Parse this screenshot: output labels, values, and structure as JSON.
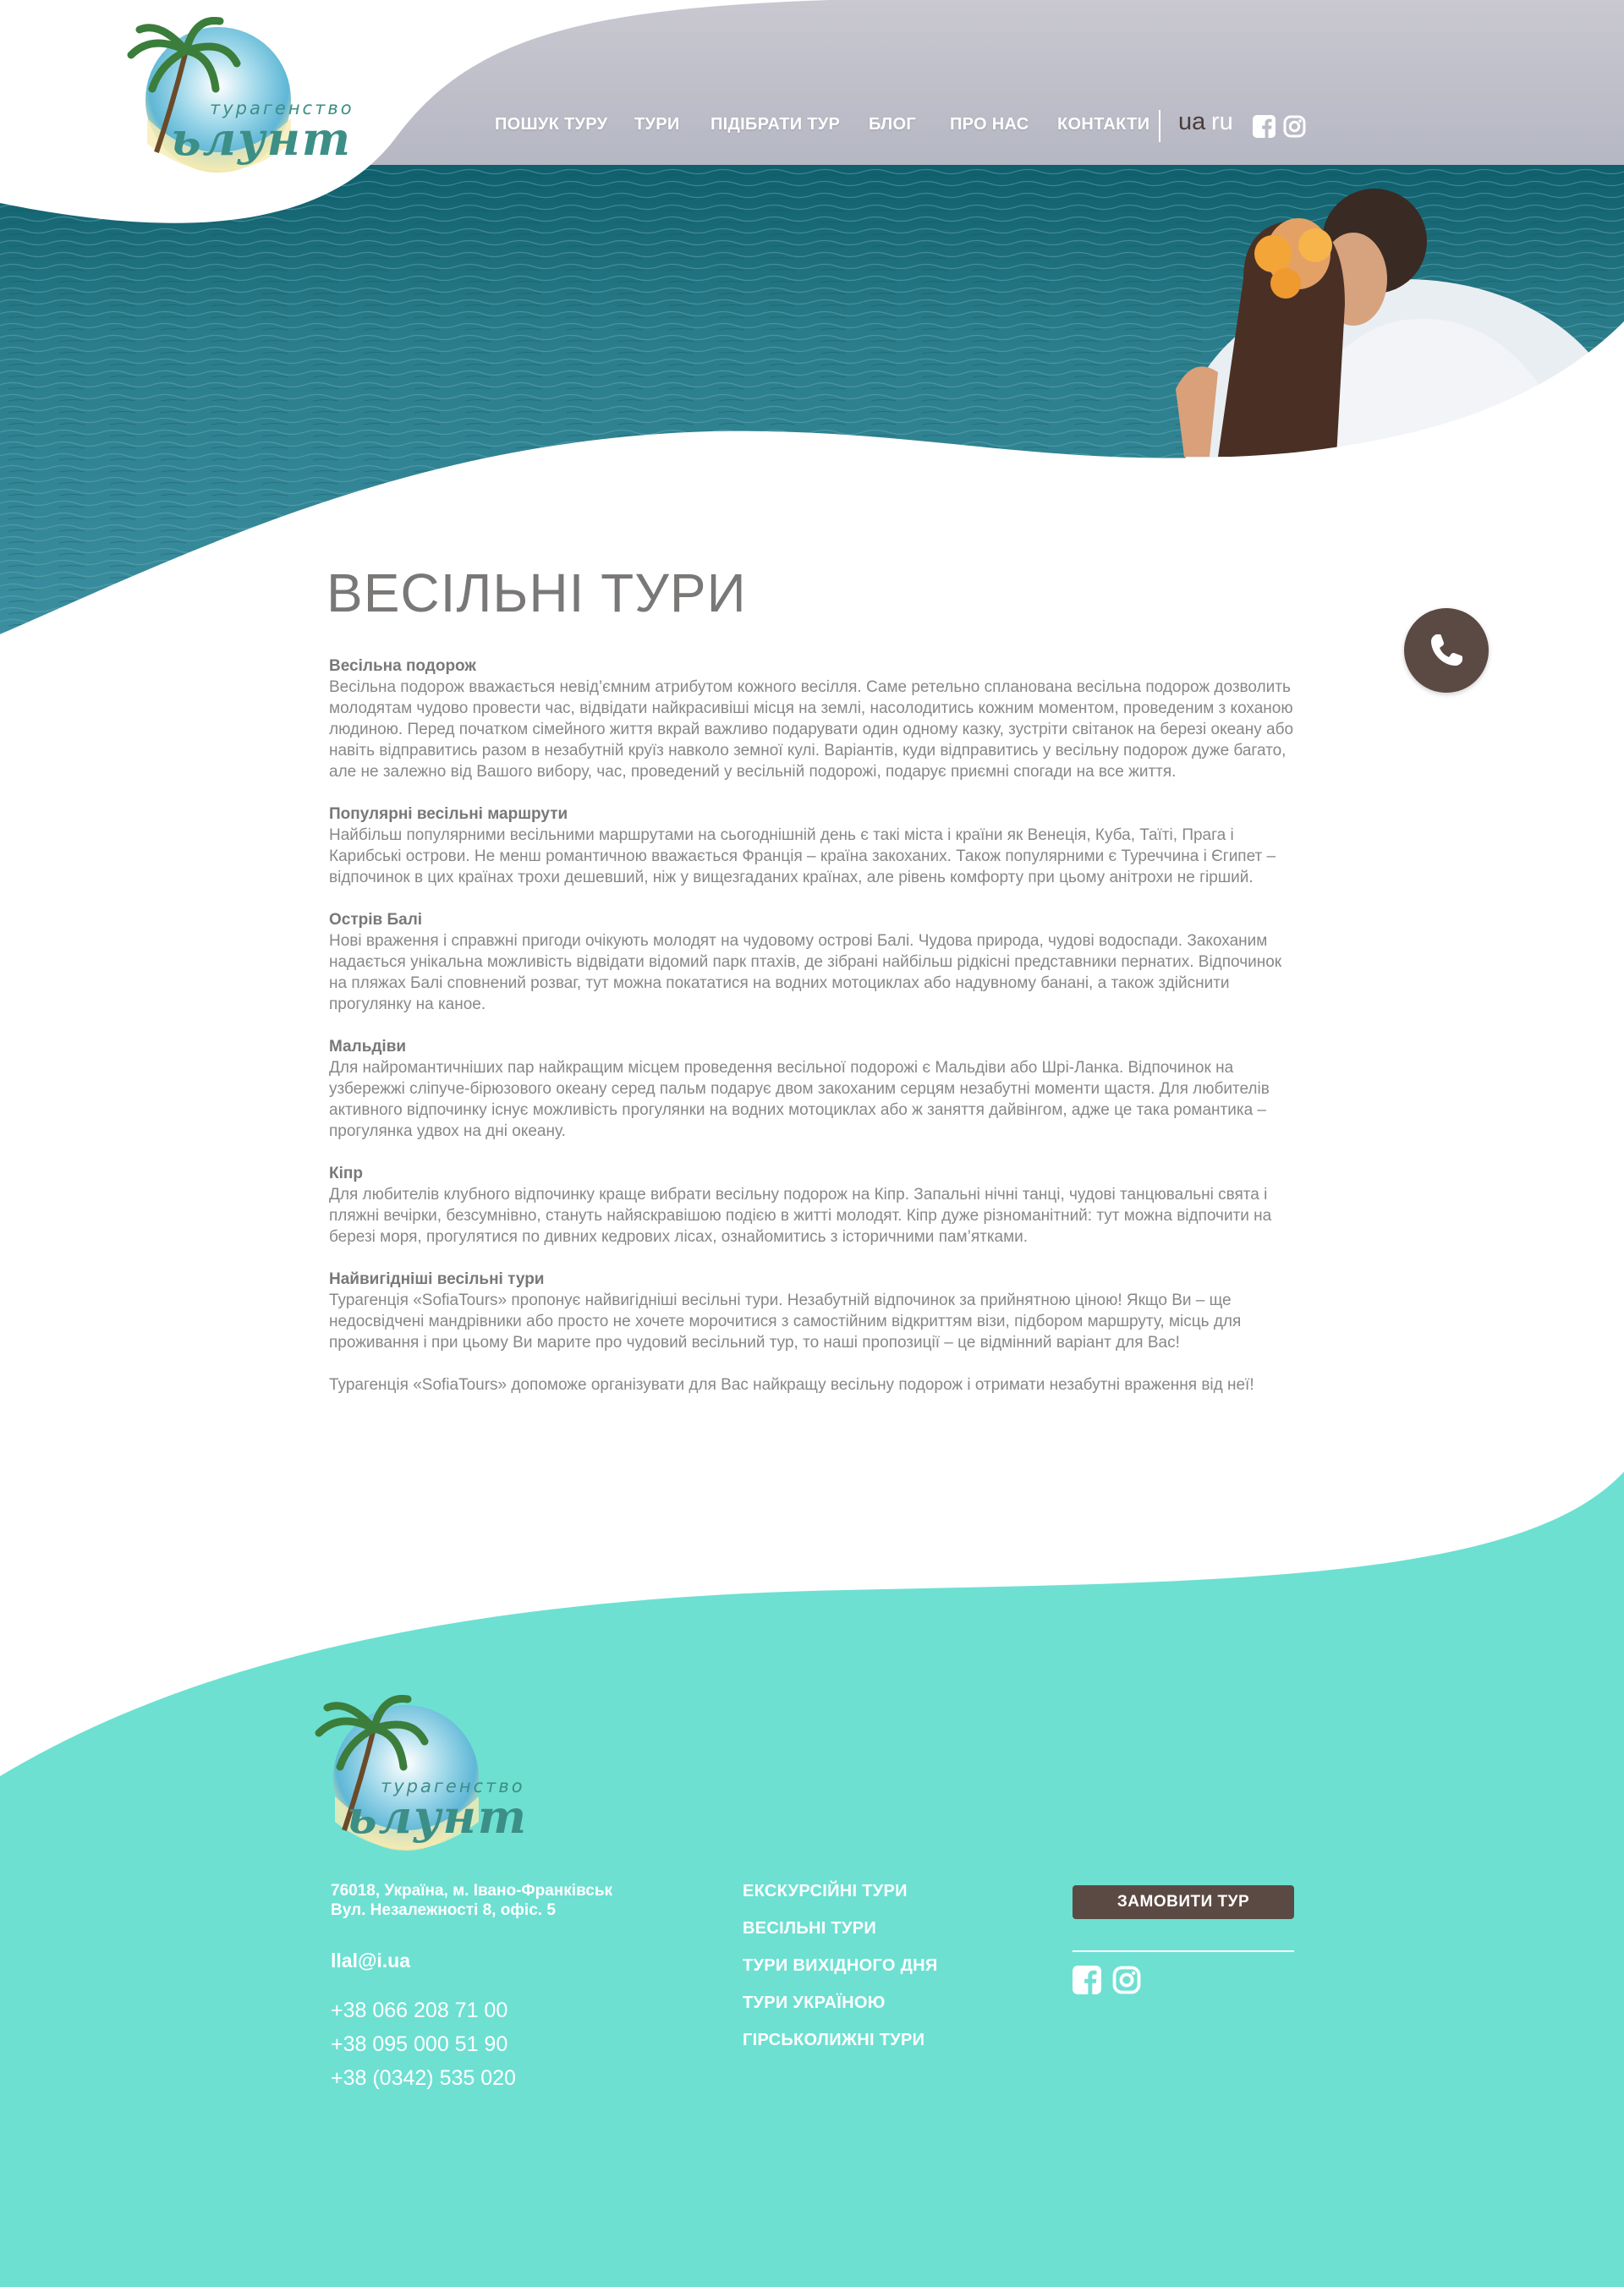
{
  "colors": {
    "accent_teal": "#6de0d2",
    "button_brown": "#5b4a43",
    "title_gray": "#7a7777",
    "body_gray": "#8a8787",
    "logo_green": "#3c8f86"
  },
  "header": {
    "logo": {
      "subtitle": "турагенство",
      "name": "ьлунт"
    },
    "nav": [
      {
        "label": "ПОШУК ТУРУ"
      },
      {
        "label": "ТУРИ"
      },
      {
        "label": "ПІДІБРАТИ ТУР"
      },
      {
        "label": "БЛОГ"
      },
      {
        "label": "ПРО НАС"
      },
      {
        "label": "КОНТАКТИ"
      }
    ],
    "languages": [
      {
        "code": "ua",
        "active": true
      },
      {
        "code": "ru",
        "active": false
      }
    ],
    "social_icons": [
      "facebook-icon",
      "instagram-icon"
    ]
  },
  "call_button": {
    "icon": "phone-icon"
  },
  "main": {
    "title": "ВЕСІЛЬНІ ТУРИ",
    "sections": [
      {
        "heading": "Весільна подорож",
        "text": "Весільна подорож вважається невід’ємним атрибутом кожного весілля. Саме ретельно спланована весільна подорож дозволить молодятам чудово провести час, відвідати найкрасивіші місця на землі, насолодитись кожним моментом, проведеним з коханою людиною. Перед початком сімейного життя вкрай важливо подарувати один одному казку, зустріти світанок на березі океану або навіть відправитись разом в незабутній круїз навколо земної кулі. Варіантів, куди відправитись у весільну подорож дуже багато, але не залежно від Вашого вибору, час, проведений у весільній подорожі, подарує приємні спогади на все життя."
      },
      {
        "heading": "Популярні весільні маршрути",
        "text": "Найбільш популярними весільними маршрутами на сьогоднішній день є такі міста і країни як Венеція, Куба, Таїті, Прага і Карибські острови. Не менш романтичною вважається Франція – країна закоханих. Також популярними є Туреччина і Єгипет – відпочинок в цих країнах трохи дешевший, ніж у вищезгаданих країнах, але рівень комфорту при цьому анітрохи не гірший."
      },
      {
        "heading": "Острів Балі",
        "text": "Нові враження і справжні пригоди очікують молодят на чудовому острові Балі. Чудова природа, чудові водоспади. Закоханим надається унікальна можливість відвідати відомий парк птахів, де зібрані найбільш рідкісні представники пернатих. Відпочинок на пляжах Балі сповнений розваг, тут можна покататися на водних мотоциклах або надувному банані, а також здійснити прогулянку на каное."
      },
      {
        "heading": "Мальдіви",
        "text": "Для найромантичніших пар найкращим місцем проведення весільної подорожі є Мальдіви або Шрі-Ланка. Відпочинок на узбережжі сліпуче-бірюзового океану серед пальм подарує двом закоханим серцям незабутні моменти щастя. Для любителів активного відпочинку існує можливість прогулянки на водних мотоциклах або ж заняття дайвінгом, адже це така романтика – прогулянка удвох на дні океану."
      },
      {
        "heading": "Кіпр",
        "text": "Для любителів клубного відпочинку краще вибрати весільну подорож на Кіпр. Запальні нічні танці, чудові танцювальні свята і пляжні вечірки, безсумнівно, стануть найяскравішою подією в житті молодят. Кіпр дуже різноманітний: тут можна відпочити на березі моря, прогулятися по дивних кедрових лісах, ознайомитись з історичними пам’ятками."
      },
      {
        "heading": "Найвигідніші весільні тури",
        "text": "Турагенція «SofiaTours» пропонує найвигідніші весільні тури. Незабутній відпочинок за прийнятною ціною! Якщо Ви – ще недосвідчені мандрівники або просто не хочете морочитися з самостійним відкриттям візи, підбором маршруту, місць для проживання і при цьому Ви марите про чудовий весільний тур, то наші пропозиції – це відмінний варіант для Вас!"
      },
      {
        "heading": "",
        "text": "Турагенція «SofiaTours» допоможе організувати для Вас найкращу весільну подорож і отримати незабутні враження від неї!"
      }
    ]
  },
  "footer": {
    "logo": {
      "subtitle": "турагенство",
      "name": "ьлунт"
    },
    "address_line1": "76018, Україна, м. Івано-Франківськ",
    "address_line2": "Вул. Незалежності 8, офіс. 5",
    "email": "llal@i.ua",
    "phones": [
      "+38 066 208 71 00",
      "+38 095 000 51 90",
      "+38 (0342) 535 020"
    ],
    "links": [
      {
        "label": "ЕКСКУРСІЙНІ ТУРИ"
      },
      {
        "label": "ВЕСІЛЬНІ ТУРИ"
      },
      {
        "label": "ТУРИ ВИХІДНОГО ДНЯ"
      },
      {
        "label": "ТУРИ УКРАЇНОЮ"
      },
      {
        "label": "ГІРСЬКОЛИЖНІ ТУРИ"
      }
    ],
    "order_button": "ЗАМОВИТИ ТУР",
    "social_icons": [
      "facebook-icon",
      "instagram-icon"
    ]
  }
}
